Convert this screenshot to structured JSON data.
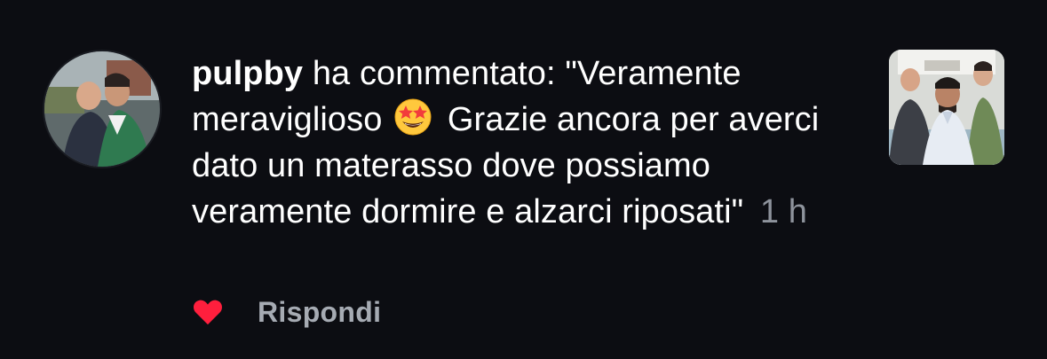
{
  "comment": {
    "username": "pulpby",
    "action_text": "ha commentato: \"Veramente meraviglioso",
    "emoji": "star-struck-emoji",
    "body_text": "Grazie ancora per averci dato un materasso dove possiamo veramente dormire e alzarci riposati\"",
    "timestamp": "1 h"
  },
  "actions": {
    "like_icon": "heart-icon",
    "like_color": "#ff1f3d",
    "reply_label": "Rispondi"
  },
  "colors": {
    "background": "#0c0d12",
    "text": "#ffffff",
    "muted": "#8e939c"
  }
}
